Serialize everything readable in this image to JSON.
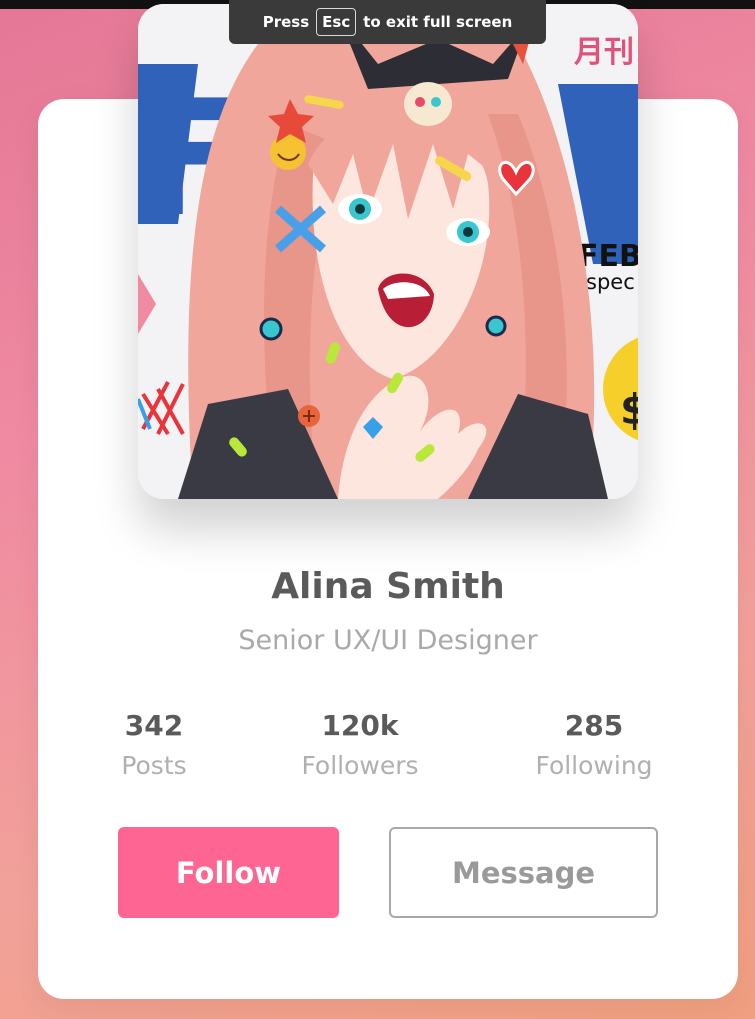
{
  "fullscreen_notice": {
    "prefix": "Press",
    "key": "Esc",
    "suffix": "to exit full screen"
  },
  "avatar": {
    "icon": "anime-portrait-image",
    "visible_text": {
      "banner_letters": "F",
      "date": "FEB",
      "sub": "spec",
      "corner": "月刊",
      "price": "$"
    }
  },
  "profile": {
    "name": "Alina Smith",
    "title": "Senior UX/UI Designer"
  },
  "stats": [
    {
      "value": "342",
      "label": "Posts"
    },
    {
      "value": "120k",
      "label": "Followers"
    },
    {
      "value": "285",
      "label": "Following"
    }
  ],
  "actions": {
    "follow_label": "Follow",
    "message_label": "Message"
  },
  "colors": {
    "accent": "#ff6592",
    "background_from": "#e47796",
    "background_to": "#f0a07f"
  }
}
